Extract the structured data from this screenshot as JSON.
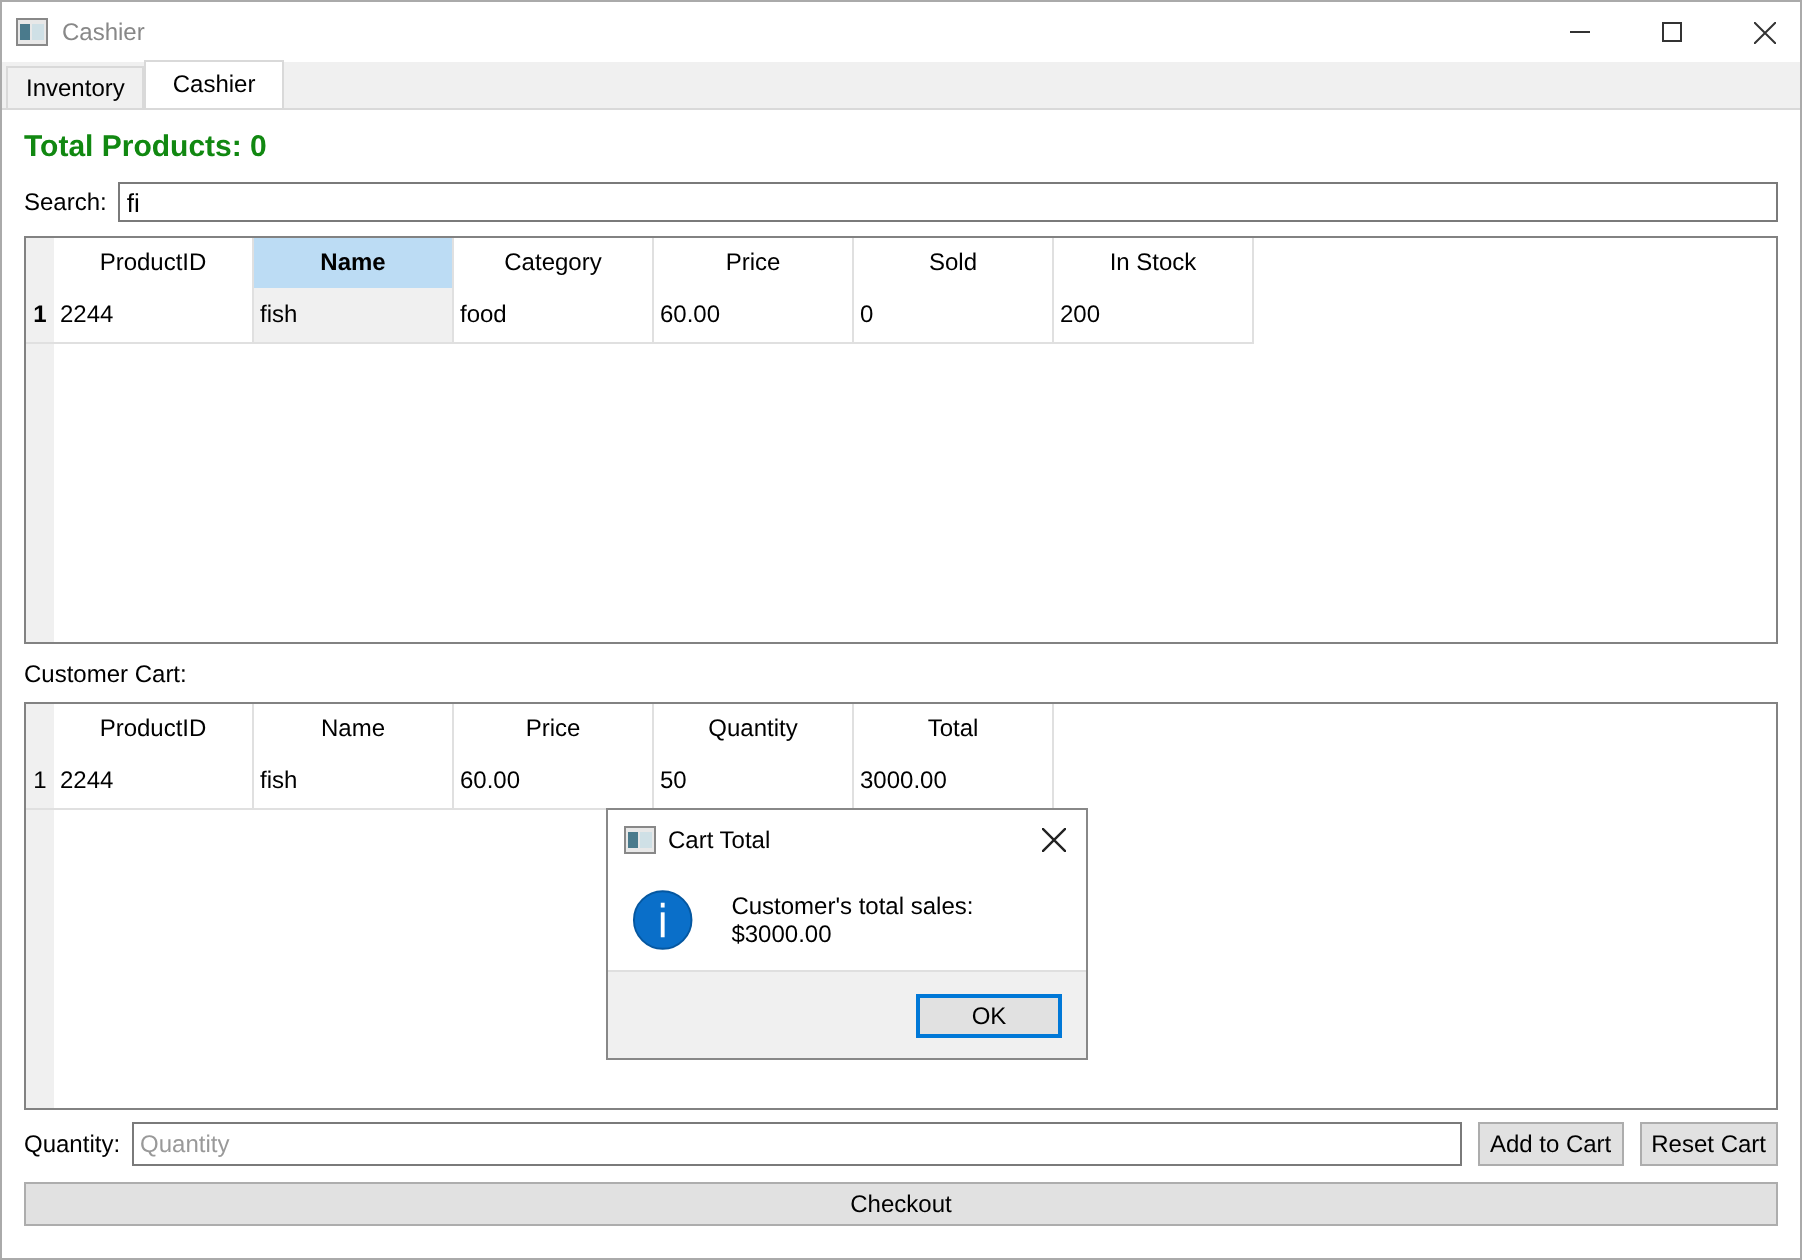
{
  "window": {
    "title": "Cashier"
  },
  "tabs": [
    {
      "label": "Inventory",
      "selected": false
    },
    {
      "label": "Cashier",
      "selected": true
    }
  ],
  "total_products": "Total Products: 0",
  "search": {
    "label": "Search:",
    "value": "fi"
  },
  "products_table": {
    "columns": [
      {
        "label": "ProductID",
        "selected": false
      },
      {
        "label": "Name",
        "selected": true
      },
      {
        "label": "Category",
        "selected": false
      },
      {
        "label": "Price",
        "selected": false
      },
      {
        "label": "Sold",
        "selected": false
      },
      {
        "label": "In Stock",
        "selected": false
      }
    ],
    "rows": [
      {
        "header": "1",
        "selected": true,
        "cells": [
          "2244",
          "fish",
          "food",
          "60.00",
          "0",
          "200"
        ]
      }
    ]
  },
  "cart_label": "Customer Cart:",
  "cart_table": {
    "columns": [
      {
        "label": "ProductID",
        "selected": false
      },
      {
        "label": "Name",
        "selected": false
      },
      {
        "label": "Price",
        "selected": false
      },
      {
        "label": "Quantity",
        "selected": false
      },
      {
        "label": "Total",
        "selected": false
      }
    ],
    "rows": [
      {
        "header": "1",
        "selected": false,
        "cells": [
          "2244",
          "fish",
          "60.00",
          "50",
          "3000.00"
        ]
      }
    ]
  },
  "quantity": {
    "label": "Quantity:",
    "placeholder": "Quantity"
  },
  "buttons": [
    "Add to Cart",
    "Reset Cart"
  ],
  "checkout": "Checkout",
  "dialog": {
    "title": "Cart Total",
    "message": "Customer's total sales: $3000.00",
    "button": "OK"
  }
}
